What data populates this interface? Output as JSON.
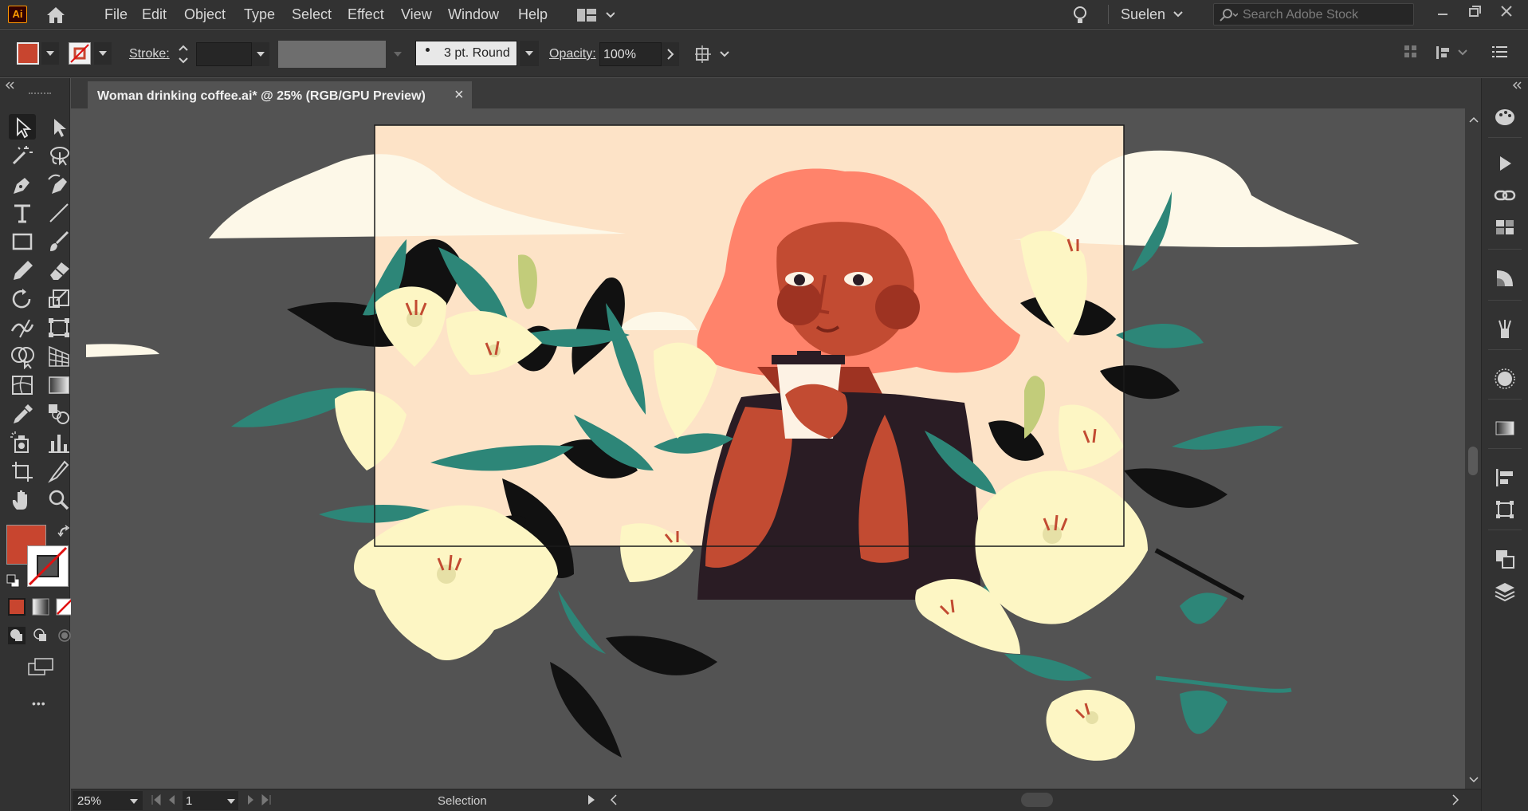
{
  "app": {
    "logo_text": "Ai",
    "menu": [
      "File",
      "Edit",
      "Object",
      "Type",
      "Select",
      "Effect",
      "View",
      "Window",
      "Help"
    ],
    "user_name": "Suelen",
    "search_placeholder": "Search Adobe Stock"
  },
  "controlbar": {
    "stroke_label": "Stroke:",
    "brush_label": "3 pt. Round",
    "opacity_label": "Opacity:",
    "opacity_value": "100%",
    "fill_color": "#c8452f"
  },
  "document": {
    "tab_title": "Woman drinking coffee.ai* @ 25% (RGB/GPU Preview)",
    "close_symbol": "×"
  },
  "toolbox": {
    "fill_color": "#c8452f",
    "more_symbol": "•••"
  },
  "statusbar": {
    "zoom": "25%",
    "artboard_number": "1",
    "tool_name": "Selection"
  },
  "icons": {
    "home": "home-icon",
    "layout": "workspace-layout-icon",
    "lightbulb": "lightbulb-icon",
    "search": "search-icon"
  },
  "colors": {
    "sky": "#fde3c7",
    "hair": "#ff836b",
    "skin": "#c24b32",
    "shirt": "#2a1c24",
    "leaf": "#2d8678",
    "lily": "#fdf6c4",
    "cloud": "#fdf8e8"
  }
}
